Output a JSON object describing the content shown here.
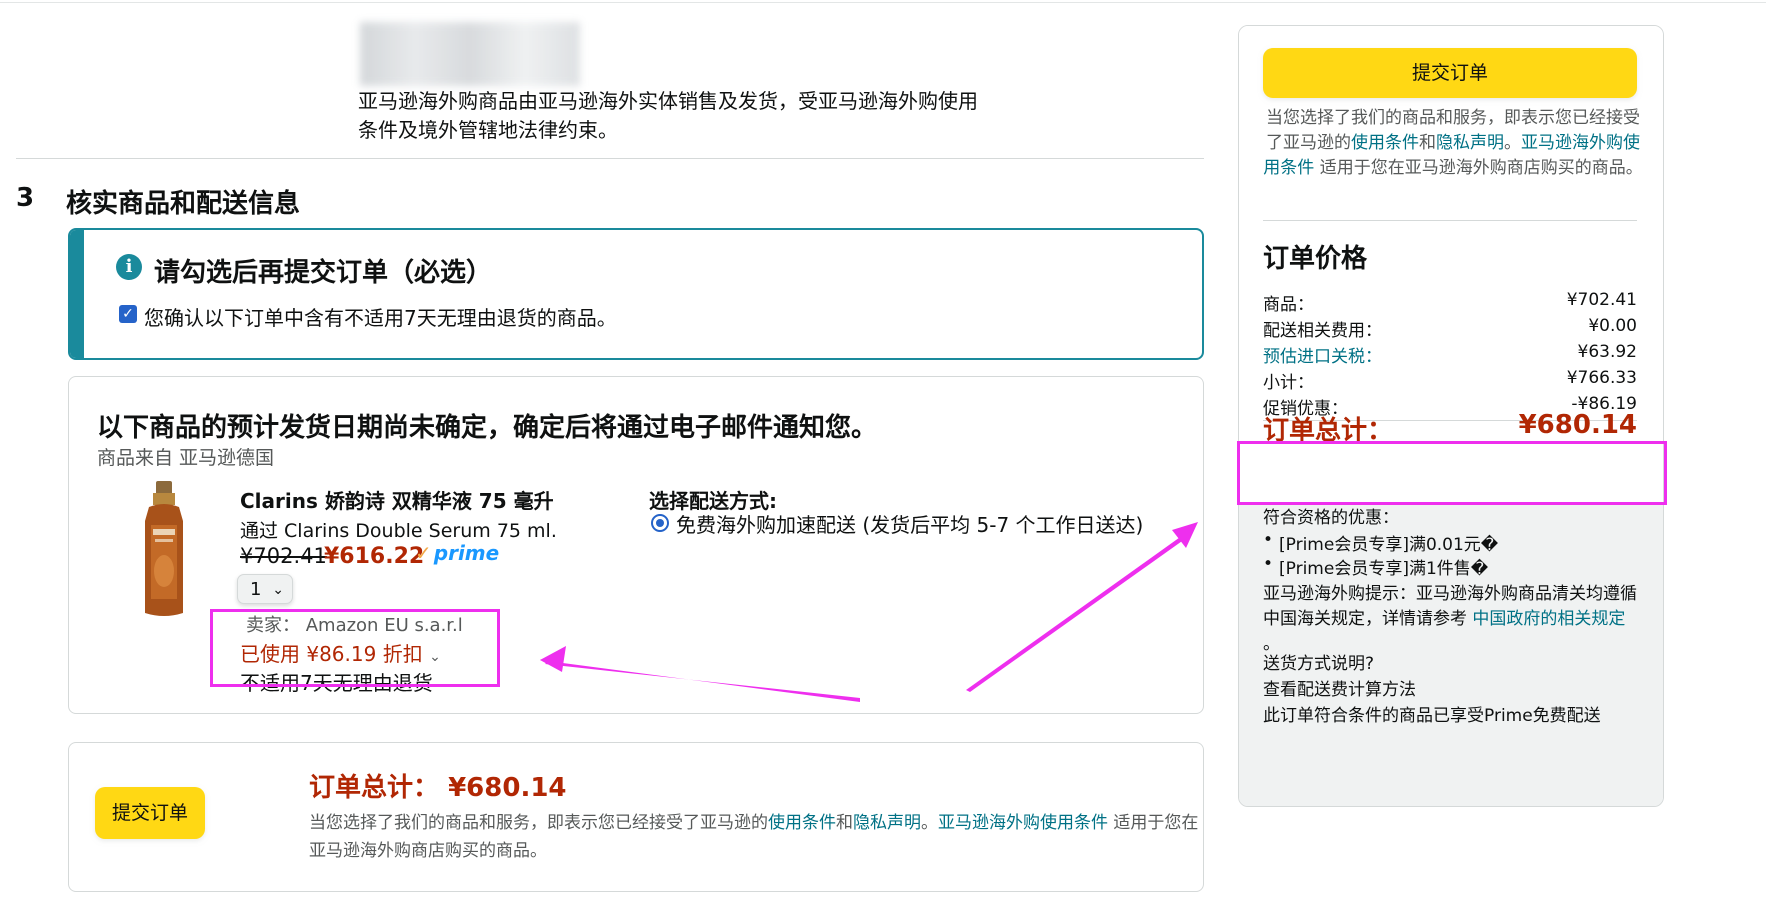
{
  "notice": {
    "line1": "亚马逊海外购商品由亚马逊海外实体销售及发货，受亚马逊海外购使用",
    "line2": "条件及境外管辖地法律约束。"
  },
  "section": {
    "number": "3",
    "title": "核实商品和配送信息"
  },
  "alert": {
    "title": "请勾选后再提交订单（必选）",
    "checkbox_label": "您确认以下订单中含有不适用7天无理由退货的商品。",
    "checked": true
  },
  "shipment": {
    "heading": "以下商品的预计发货日期尚未确定，确定后将通过电子邮件通知您。",
    "origin": "商品来自 亚马逊德国",
    "product": {
      "name": "Clarins 娇韵诗 双精华液 75 毫升",
      "subtitle": "通过 Clarins Double Serum 75 ml.",
      "price_old": "¥702.41",
      "price_new": "¥616.22",
      "prime": "prime",
      "quantity": "1",
      "seller": "卖家： Amazon EU s.a.r.l",
      "discount": "已使用 ¥86.19 折扣",
      "no_return": "不适用7天无理由退货"
    },
    "delivery": {
      "label": "选择配送方式:",
      "option": "免费海外购加速配送 (发货后平均 5-7 个工作日送达)"
    }
  },
  "bottom": {
    "submit": "提交订单",
    "total_label": "订单总计：",
    "total_value": "¥680.14",
    "terms_pre": "当您选择了我们的商品和服务，即表示您已经接受了亚马逊的",
    "terms_link1": "使用条件",
    "terms_and": "和",
    "terms_link2": "隐私声明",
    "terms_dot": "。",
    "terms_link3": "亚马逊海外购使用条件",
    "terms_post": " 适用于您在亚马逊海外购商店购买的商品。"
  },
  "sidebar": {
    "submit": "提交订单",
    "terms_pre": "当您选择了我们的商品和服务，即表示您已经接受了亚马逊的",
    "terms_link1": "使用条件",
    "terms_and": "和",
    "terms_link2": "隐私声明",
    "terms_dot": "。",
    "terms_link3": "亚马逊海外购使用条件",
    "terms_post": " 适用于您在亚马逊海外购商店购买的商品。",
    "price_title": "订单价格",
    "rows": [
      {
        "label": "商品：",
        "value": "¥702.41"
      },
      {
        "label": "配送相关费用：",
        "value": "¥0.00"
      },
      {
        "label": "预估进口关税：",
        "value": "¥63.92"
      },
      {
        "label": "小计：",
        "value": "¥766.33"
      },
      {
        "label": "促销优惠：",
        "value": "-¥86.19"
      }
    ],
    "total_label": "订单总计：",
    "total_value": "¥680.14",
    "promo_heading": "符合资格的优惠：",
    "promos": [
      "[Prime会员专享]满0.01元�",
      "[Prime会员专享]满1件售�"
    ],
    "tip_pre": "亚马逊海外购提示：亚马逊海外购商品清关均遵循中国海关规定，详情请参考 ",
    "tip_link": "中国政府的相关规定",
    "tip_post": " 。",
    "link_shipping": "送货方式说明?",
    "link_fee": "查看配送费计算方法",
    "prime_note": "此订单符合条件的商品已享受Prime免费配送"
  },
  "colors": {
    "accent_teal": "#1a8a9c",
    "price_red": "#b12704",
    "button_yellow": "#ffd814",
    "link": "#007185",
    "annotation_magenta": "#ee2fee"
  }
}
